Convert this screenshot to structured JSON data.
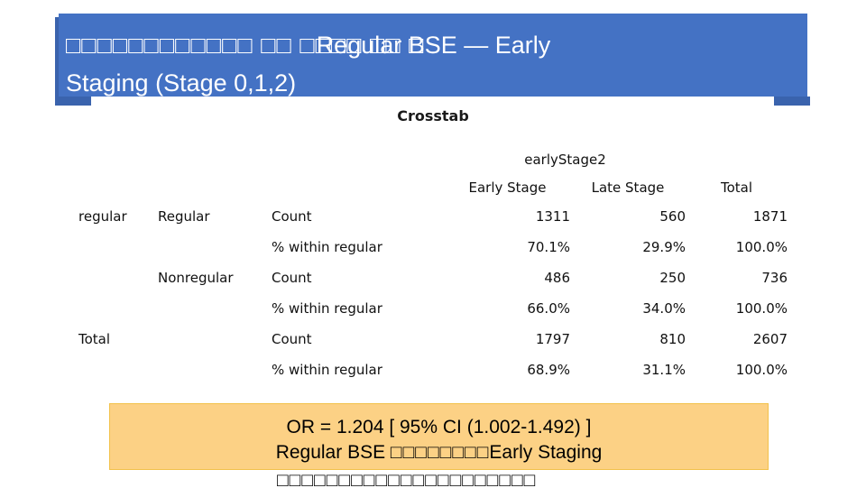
{
  "banner": {
    "tofu_prefix": "□□□□□□□□□□□□ □□ □□□□ □□ □",
    "overlay_text": "Regular BSE — Early",
    "line2": "Staging (Stage 0,1,2)",
    "background_color": "#4472C4",
    "text_color": "#FFFFFF"
  },
  "crosstab": {
    "caption": "Crosstab",
    "column_group_label": "earlyStage2",
    "column_headers": [
      "Early Stage",
      "Late Stage"
    ],
    "total_header": "Total",
    "row_variable_label": "regular",
    "stat_labels": [
      "Count",
      "% within regular"
    ],
    "rows": [
      {
        "group": "regular",
        "category": "Regular",
        "count": {
          "early_stage": "1311",
          "late_stage": "560",
          "total": "1871"
        },
        "percent": {
          "early_stage": "70.1%",
          "late_stage": "29.9%",
          "total": "100.0%"
        }
      },
      {
        "group": "",
        "category": "Nonregular",
        "count": {
          "early_stage": "486",
          "late_stage": "250",
          "total": "736"
        },
        "percent": {
          "early_stage": "66.0%",
          "late_stage": "34.0%",
          "total": "100.0%"
        }
      }
    ],
    "total_row": {
      "label": "Total",
      "count": {
        "early_stage": "1797",
        "late_stage": "810",
        "total": "2607"
      },
      "percent": {
        "early_stage": "68.9%",
        "late_stage": "31.1%",
        "total": "100.0%"
      }
    }
  },
  "callout": {
    "line1": "OR = 1.204  [ 95% CI (1.002-1.492) ]",
    "line2_prefix": "Regular BSE ",
    "line2_tofu": "□□□□□□□□",
    "line2_overlay": "Early Staging",
    "background_color": "#FCD185",
    "border_color": "#F2C14A"
  },
  "bottom_strip": {
    "tofu": "□□□□□□□□□□□□□□□□□□□□□"
  }
}
